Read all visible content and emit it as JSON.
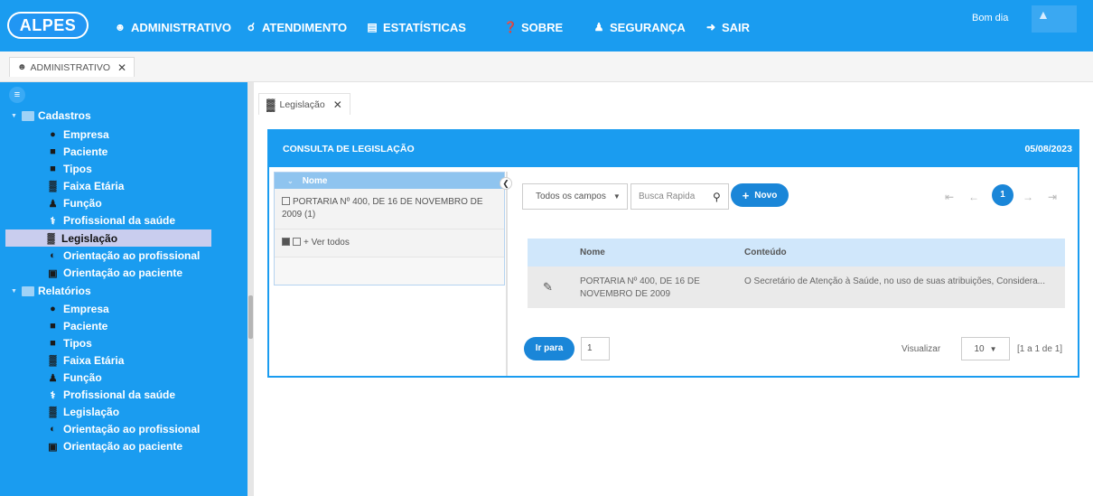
{
  "app": {
    "logo": "ALPES",
    "greeting": "Bom dia"
  },
  "nav": [
    {
      "label": "ADMINISTRATIVO",
      "icon": "users-icon"
    },
    {
      "label": "ATENDIMENTO",
      "icon": "headset-icon"
    },
    {
      "label": "ESTATÍSTICAS",
      "icon": "chart-icon"
    },
    {
      "label": "SOBRE",
      "icon": "question-icon"
    },
    {
      "label": "SEGURANÇA",
      "icon": "user-plus-icon"
    },
    {
      "label": "SAIR",
      "icon": "sign-out-icon"
    }
  ],
  "main_tab": {
    "label": "ADMINISTRATIVO"
  },
  "sidebar": {
    "groups": [
      {
        "label": "Cadastros",
        "items": [
          {
            "label": "Empresa",
            "icon": "location-icon"
          },
          {
            "label": "Paciente",
            "icon": "person-icon"
          },
          {
            "label": "Tipos",
            "icon": "person-icon"
          },
          {
            "label": "Faixa Etária",
            "icon": "age-chart-icon"
          },
          {
            "label": "Função",
            "icon": "user-role-icon"
          },
          {
            "label": "Profissional da saúde",
            "icon": "stethoscope-icon"
          },
          {
            "label": "Legislação",
            "icon": "legislation-icon",
            "active": true
          },
          {
            "label": "Orientação ao profissional",
            "icon": "toggle-icon"
          },
          {
            "label": "Orientação ao paciente",
            "icon": "clipboard-icon"
          }
        ]
      },
      {
        "label": "Relatórios",
        "items": [
          {
            "label": "Empresa",
            "icon": "location-icon"
          },
          {
            "label": "Paciente",
            "icon": "person-icon"
          },
          {
            "label": "Tipos",
            "icon": "person-icon"
          },
          {
            "label": "Faixa Etária",
            "icon": "age-chart-icon"
          },
          {
            "label": "Função",
            "icon": "user-role-icon"
          },
          {
            "label": "Profissional da saúde",
            "icon": "stethoscope-icon"
          },
          {
            "label": "Legislação",
            "icon": "legislation-icon"
          },
          {
            "label": "Orientação ao profissional",
            "icon": "toggle-icon"
          },
          {
            "label": "Orientação ao paciente",
            "icon": "clipboard-icon"
          }
        ]
      }
    ]
  },
  "content_tab": {
    "label": "Legislação"
  },
  "panel": {
    "title": "CONSULTA DE LEGISLAÇÃO",
    "date": "05/08/2023"
  },
  "filter": {
    "header": "Nome",
    "rows": [
      {
        "label": "PORTARIA Nº 400, DE 16 DE NOVEMBRO DE 2009 (1)"
      },
      {
        "label": "+ Ver todos"
      }
    ]
  },
  "toolbar": {
    "field_select": "Todos os campos",
    "search_placeholder": "Busca Rapida",
    "new_label": "Novo"
  },
  "pager": {
    "current": "1"
  },
  "table": {
    "columns": [
      "Nome",
      "Conteúdo"
    ],
    "rows": [
      {
        "nome": "PORTARIA Nº 400, DE 16 DE NOVEMBRO DE 2009",
        "conteudo": "O Secretário de Atenção à Saúde, no uso de suas atribuições, Considera..."
      }
    ]
  },
  "footer": {
    "goto_label": "Ir para",
    "goto_value": "1",
    "view_label": "Visualizar",
    "page_size": "10",
    "range": "[1 a 1 de 1]"
  },
  "colors": {
    "primary": "#1a9cf0",
    "button": "#1a86d8",
    "active_item": "#c9cdee",
    "table_head": "#d0e7fb"
  }
}
